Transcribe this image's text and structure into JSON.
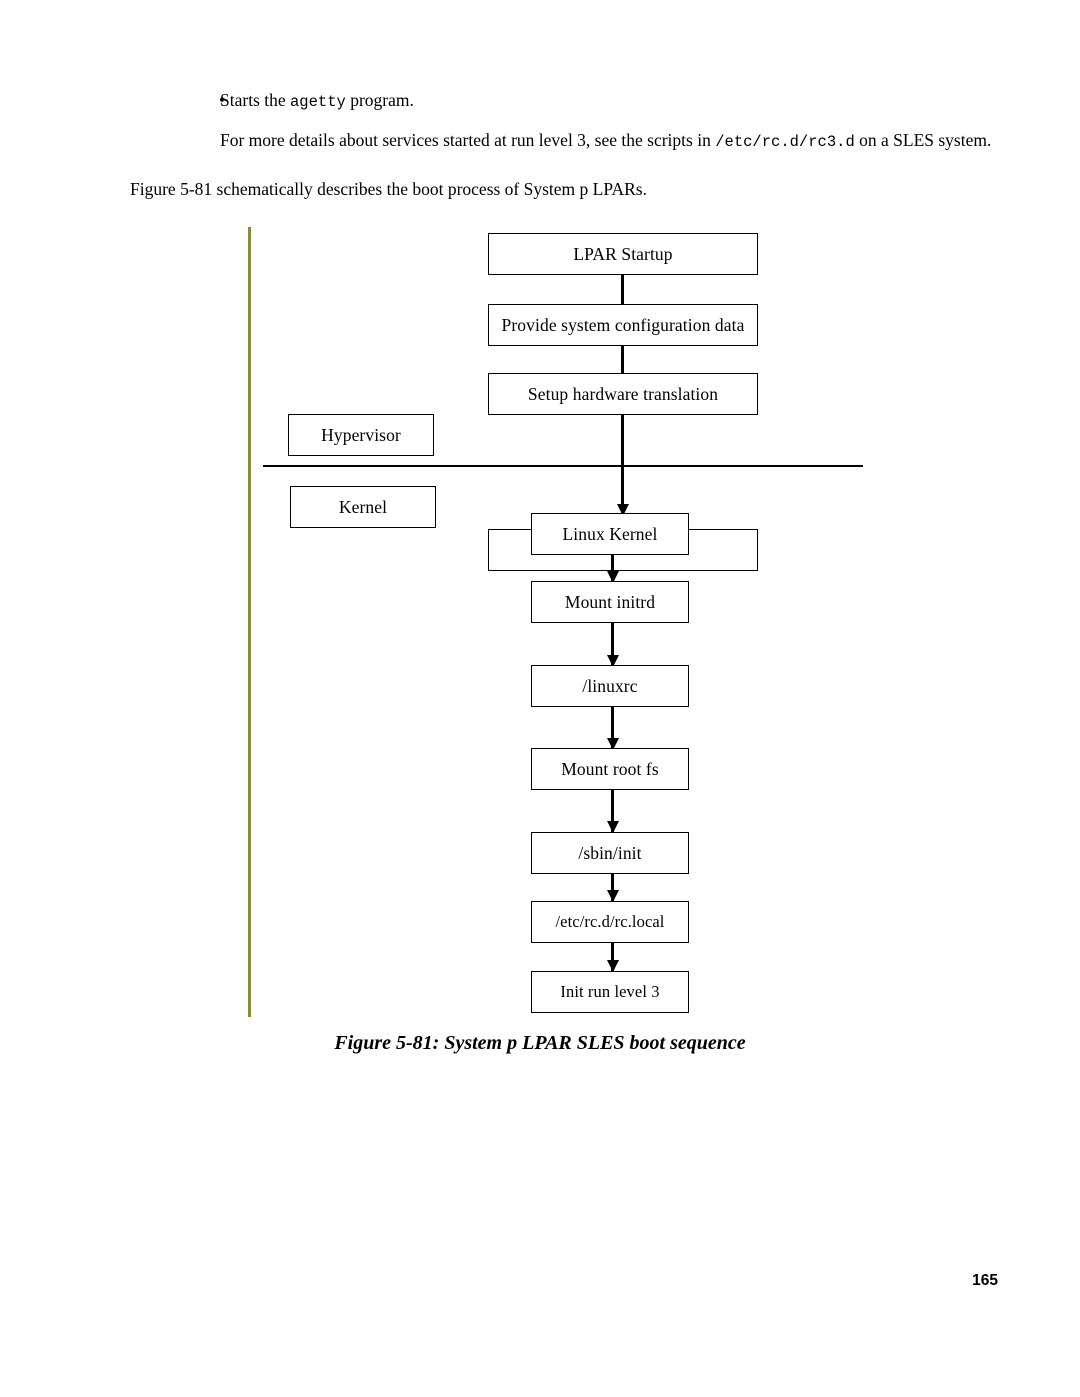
{
  "body": {
    "bullet": {
      "marker": "•",
      "text_before": "Starts the ",
      "code": "agetty",
      "text_after": " program."
    },
    "paragraph": {
      "text_before": "For more details about services started at run level 3, see the scripts in ",
      "code": "/etc/rc.d/rc3.d",
      "text_after": " on a SLES system."
    },
    "intro": "Figure 5-81 schematically describes the boot process of System p LPARs."
  },
  "figure": {
    "caption": "Figure 5-81: System p LPAR SLES boot sequence",
    "labels": {
      "hypervisor": "Hypervisor",
      "kernel": "Kernel"
    },
    "flow": [
      "LPAR Startup",
      "Provide system configuration data",
      "Setup hardware translation",
      "Linux Kernel",
      "Mount initrd",
      "/linuxrc",
      "Mount root fs",
      "/sbin/init",
      "/etc/rc.d/rc.local",
      "Init run level 3"
    ]
  },
  "page_number": "165"
}
